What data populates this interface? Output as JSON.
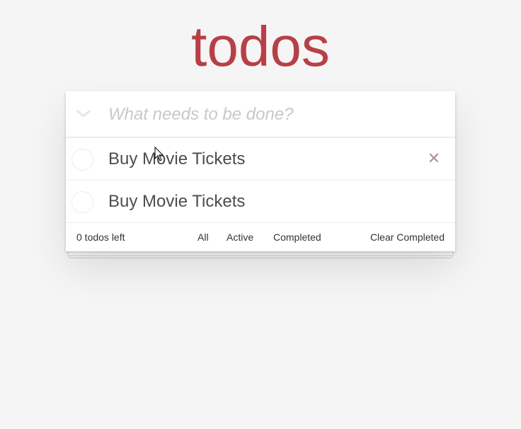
{
  "app": {
    "title": "todos"
  },
  "input": {
    "placeholder": "What needs to be done?",
    "value": ""
  },
  "todos": [
    {
      "label": "Buy Movie Tickets",
      "completed": false
    },
    {
      "label": "Buy Movie Tickets",
      "completed": false
    }
  ],
  "footer": {
    "count_text": "0 todos left",
    "filters": [
      "All",
      "Active",
      "Completed"
    ],
    "clear_label": "Clear Completed"
  },
  "colors": {
    "title": "#b83f45",
    "background": "#f5f5f5",
    "destroy": "#af8f8b"
  },
  "icons": {
    "toggle_all": "chevron-down-icon",
    "destroy": "close-icon"
  }
}
